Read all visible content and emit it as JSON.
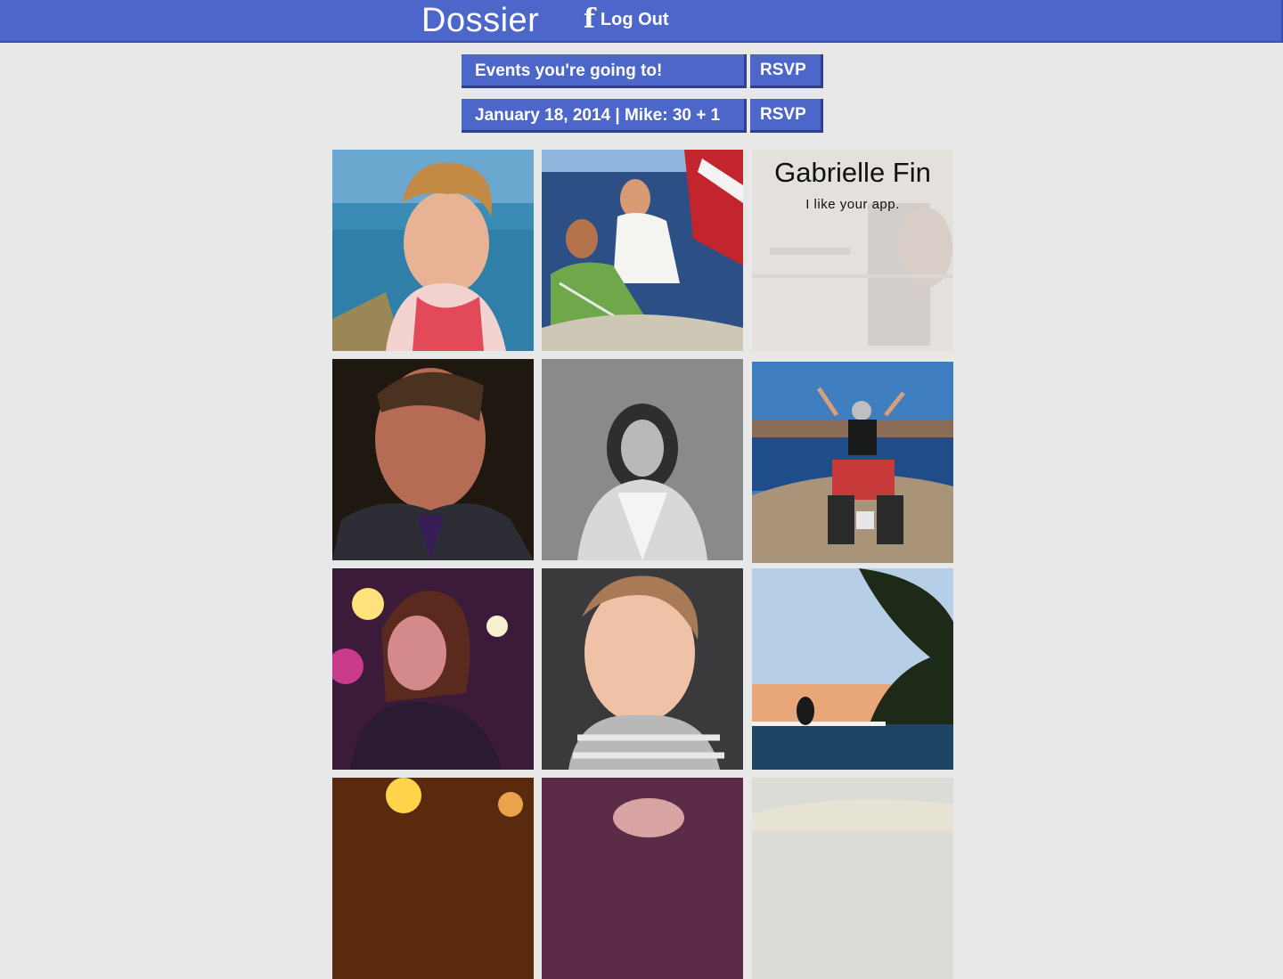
{
  "header": {
    "brand": "Dossier",
    "fb_icon": "facebook-icon",
    "logout_label": "Log Out"
  },
  "events": [
    {
      "title": "Events you're going to!",
      "rsvp_label": "RSVP"
    },
    {
      "title": "January 18, 2014 | Mike: 30 + 1",
      "rsvp_label": "RSVP"
    }
  ],
  "grid": {
    "overlay": {
      "name": "Gabrielle Fin",
      "message": "I like your app."
    }
  },
  "colors": {
    "brand_blue": "#4d66c9",
    "page_bg": "#e8e8e8"
  }
}
